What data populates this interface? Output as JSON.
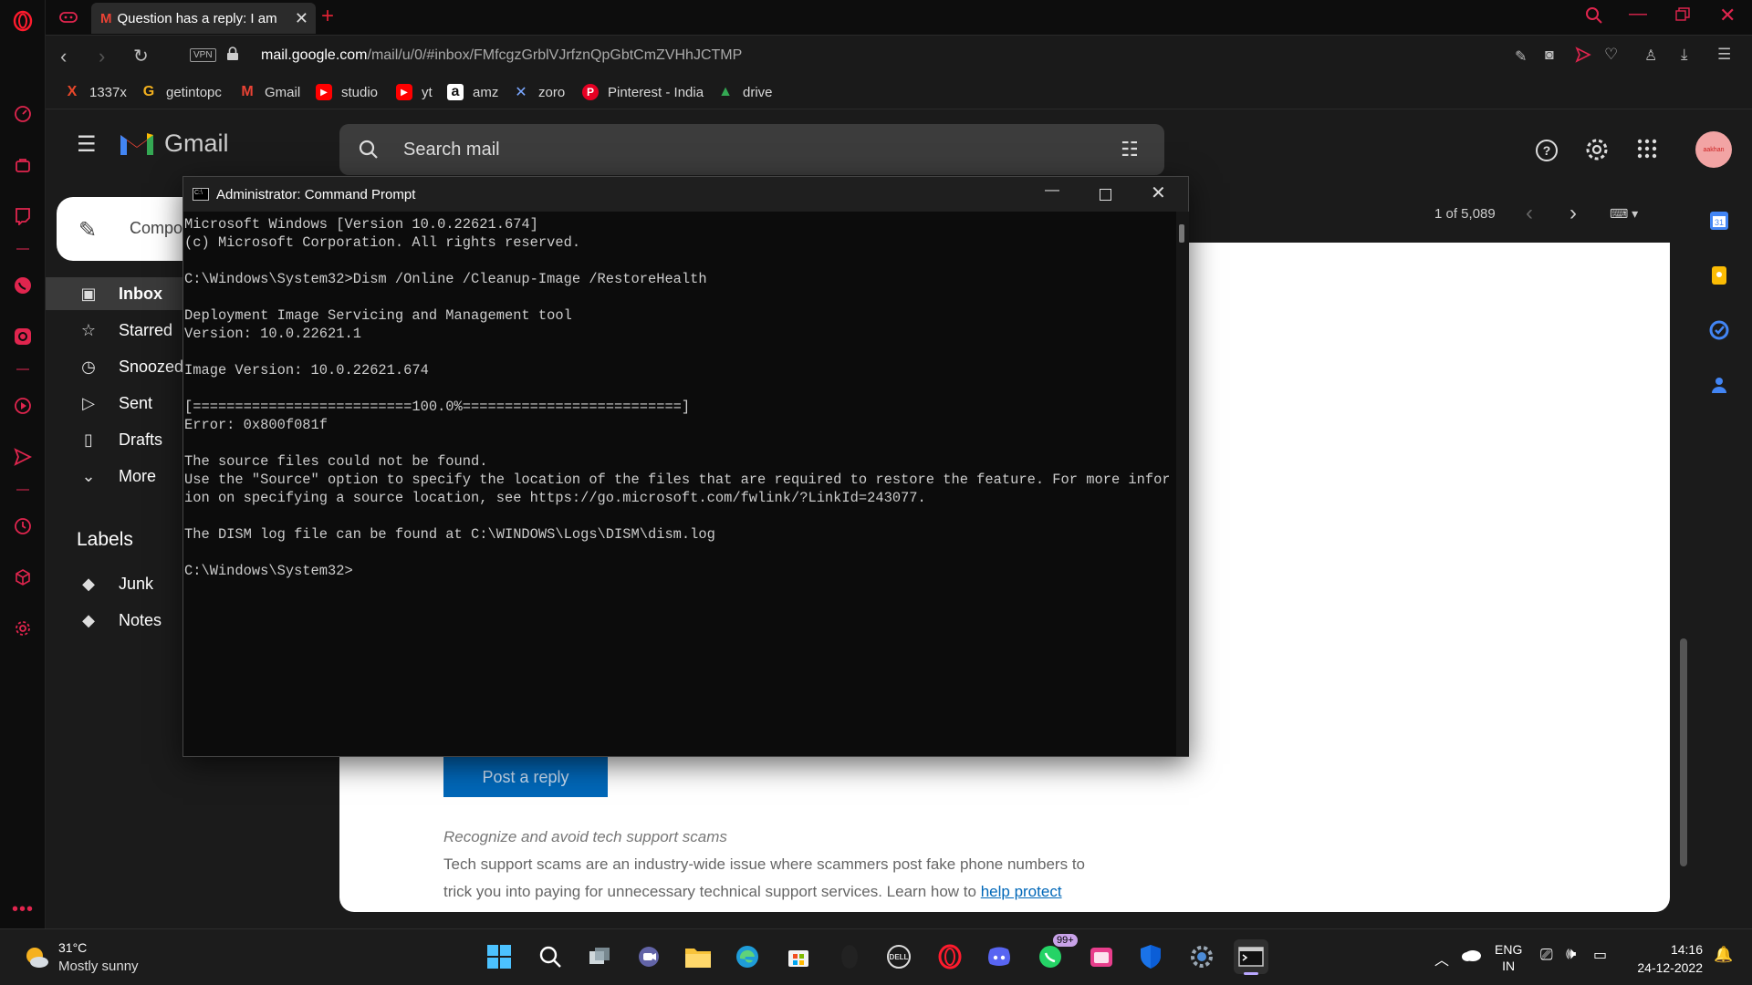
{
  "browser": {
    "active_tab_title": "Question has a reply: I am ",
    "url_domain": "mail.google.com",
    "url_path": "/mail/u/0/#inbox/FMfcgzGrblVJrfznQpGbtCmZVHhJCTMP",
    "vpn_badge": "VPN",
    "bookmarks": [
      {
        "label": "1337x",
        "icon": "X",
        "color": "#e8472a"
      },
      {
        "label": "getintopc",
        "icon": "G",
        "color": "#f2b01e"
      },
      {
        "label": "Gmail",
        "icon": "M",
        "color": "#ea4335"
      },
      {
        "label": "studio",
        "icon": "▶",
        "color": "#ff0000"
      },
      {
        "label": "yt",
        "icon": "▶",
        "color": "#ff0000"
      },
      {
        "label": "amz",
        "icon": "a",
        "color": "#ffffff"
      },
      {
        "label": "zoro",
        "icon": "✕",
        "color": "#7aa7ff"
      },
      {
        "label": "Pinterest - India",
        "icon": "P",
        "color": "#e60023"
      },
      {
        "label": "drive",
        "icon": "▲",
        "color": "#34a853"
      }
    ]
  },
  "gmail": {
    "logo_text": "Gmail",
    "search_placeholder": "Search mail",
    "compose_label": "Compose",
    "nav": [
      {
        "label": "Inbox",
        "icon": "inbox",
        "active": true
      },
      {
        "label": "Starred",
        "icon": "star"
      },
      {
        "label": "Snoozed",
        "icon": "clock"
      },
      {
        "label": "Sent",
        "icon": "send"
      },
      {
        "label": "Drafts",
        "icon": "draft"
      },
      {
        "label": "More",
        "icon": "chevron-down"
      }
    ],
    "labels_heading": "Labels",
    "labels": [
      "Junk",
      "Notes"
    ],
    "pagination": "1 of 5,089",
    "avatar_text": "aakhan",
    "reply_button": "Post a reply",
    "scam_heading": "Recognize and avoid tech support scams",
    "scam_text_1": "Tech support scams are an industry-wide issue where scammers post fake phone numbers to",
    "scam_text_2": "trick you into paying for unnecessary technical support services. Learn how to ",
    "scam_link": "help protect"
  },
  "cmd": {
    "title": "Administrator: Command Prompt",
    "lines": [
      "Microsoft Windows [Version 10.0.22621.674]",
      "(c) Microsoft Corporation. All rights reserved.",
      "",
      "C:\\Windows\\System32>Dism /Online /Cleanup-Image /RestoreHealth",
      "",
      "Deployment Image Servicing and Management tool",
      "Version: 10.0.22621.1",
      "",
      "Image Version: 10.0.22621.674",
      "",
      "[==========================100.0%==========================]",
      "Error: 0x800f081f",
      "",
      "The source files could not be found.",
      "Use the \"Source\" option to specify the location of the files that are required to restore the feature. For more informat",
      "ion on specifying a source location, see https://go.microsoft.com/fwlink/?LinkId=243077.",
      "",
      "The DISM log file can be found at C:\\WINDOWS\\Logs\\DISM\\dism.log",
      "",
      "C:\\Windows\\System32>"
    ]
  },
  "taskbar": {
    "weather_temp": "31°C",
    "weather_desc": "Mostly sunny",
    "lang_1": "ENG",
    "lang_2": "IN",
    "time": "14:16",
    "date": "24-12-2022",
    "whatsapp_badge": "99+"
  }
}
